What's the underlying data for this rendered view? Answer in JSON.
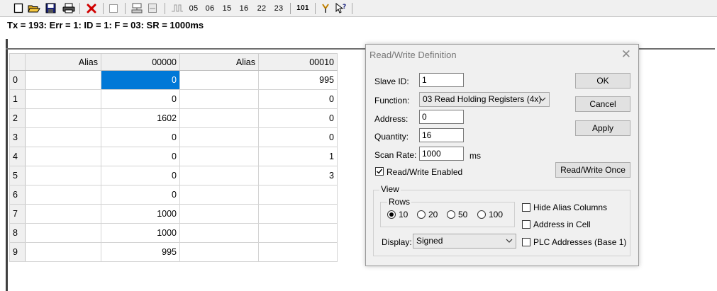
{
  "toolbar": {
    "items": [
      "05",
      "06",
      "15",
      "16",
      "22",
      "23",
      "101"
    ]
  },
  "status_line": "Tx = 193: Err = 1: ID = 1: F = 03: SR = 1000ms",
  "grid": {
    "headers": [
      "Alias",
      "00000",
      "Alias",
      "00010"
    ],
    "rows": [
      {
        "num": "0",
        "alias1": "",
        "val1": "0",
        "alias2": "",
        "val2": "995"
      },
      {
        "num": "1",
        "alias1": "",
        "val1": "0",
        "alias2": "",
        "val2": "0"
      },
      {
        "num": "2",
        "alias1": "",
        "val1": "1602",
        "alias2": "",
        "val2": "0"
      },
      {
        "num": "3",
        "alias1": "",
        "val1": "0",
        "alias2": "",
        "val2": "0"
      },
      {
        "num": "4",
        "alias1": "",
        "val1": "0",
        "alias2": "",
        "val2": "1"
      },
      {
        "num": "5",
        "alias1": "",
        "val1": "0",
        "alias2": "",
        "val2": "3"
      },
      {
        "num": "6",
        "alias1": "",
        "val1": "0",
        "alias2": "",
        "val2": ""
      },
      {
        "num": "7",
        "alias1": "",
        "val1": "1000",
        "alias2": "",
        "val2": ""
      },
      {
        "num": "8",
        "alias1": "",
        "val1": "1000",
        "alias2": "",
        "val2": ""
      },
      {
        "num": "9",
        "alias1": "",
        "val1": "995",
        "alias2": "",
        "val2": ""
      }
    ],
    "selection_color": "#0078d7"
  },
  "dialog": {
    "title": "Read/Write Definition",
    "slave_id_label": "Slave ID:",
    "slave_id_value": "1",
    "function_label": "Function:",
    "function_value": "03 Read Holding Registers (4x)",
    "address_label": "Address:",
    "address_value": "0",
    "quantity_label": "Quantity:",
    "quantity_value": "16",
    "scan_rate_label": "Scan Rate:",
    "scan_rate_value": "1000",
    "scan_rate_unit": "ms",
    "rw_enabled_label": "Read/Write Enabled",
    "ok_label": "OK",
    "cancel_label": "Cancel",
    "apply_label": "Apply",
    "rw_once_label": "Read/Write Once",
    "view_label": "View",
    "rows_label": "Rows",
    "rows_options": [
      "10",
      "20",
      "50",
      "100"
    ],
    "rows_selected": "10",
    "display_label": "Display:",
    "display_value": "Signed",
    "hide_alias_label": "Hide Alias Columns",
    "address_in_cell_label": "Address in Cell",
    "plc_addresses_label": "PLC Addresses (Base 1)"
  }
}
